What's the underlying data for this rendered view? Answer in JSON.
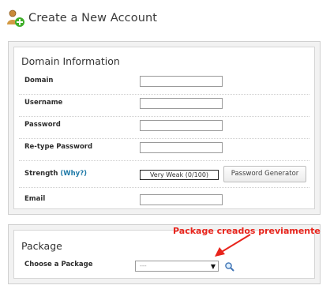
{
  "header": {
    "title": "Create a New Account",
    "icon": "add-user-icon"
  },
  "domain_section": {
    "title": "Domain Information",
    "fields": [
      {
        "label": "Domain",
        "value": ""
      },
      {
        "label": "Username",
        "value": ""
      },
      {
        "label": "Password",
        "value": ""
      },
      {
        "label": "Re-type Password",
        "value": ""
      }
    ],
    "strength": {
      "label": "Strength",
      "why_link": "(Why?)",
      "meter_text": "Very Weak (0/100)",
      "generator_button": "Password Generator"
    },
    "email": {
      "label": "Email",
      "value": ""
    }
  },
  "package_section": {
    "title": "Package",
    "choose_label": "Choose a Package",
    "selected_value": "---",
    "arrow": "▼",
    "search_icon": "magnifier-icon"
  },
  "annotation": {
    "text": "Package creados previamente",
    "color": "#e8241c"
  }
}
